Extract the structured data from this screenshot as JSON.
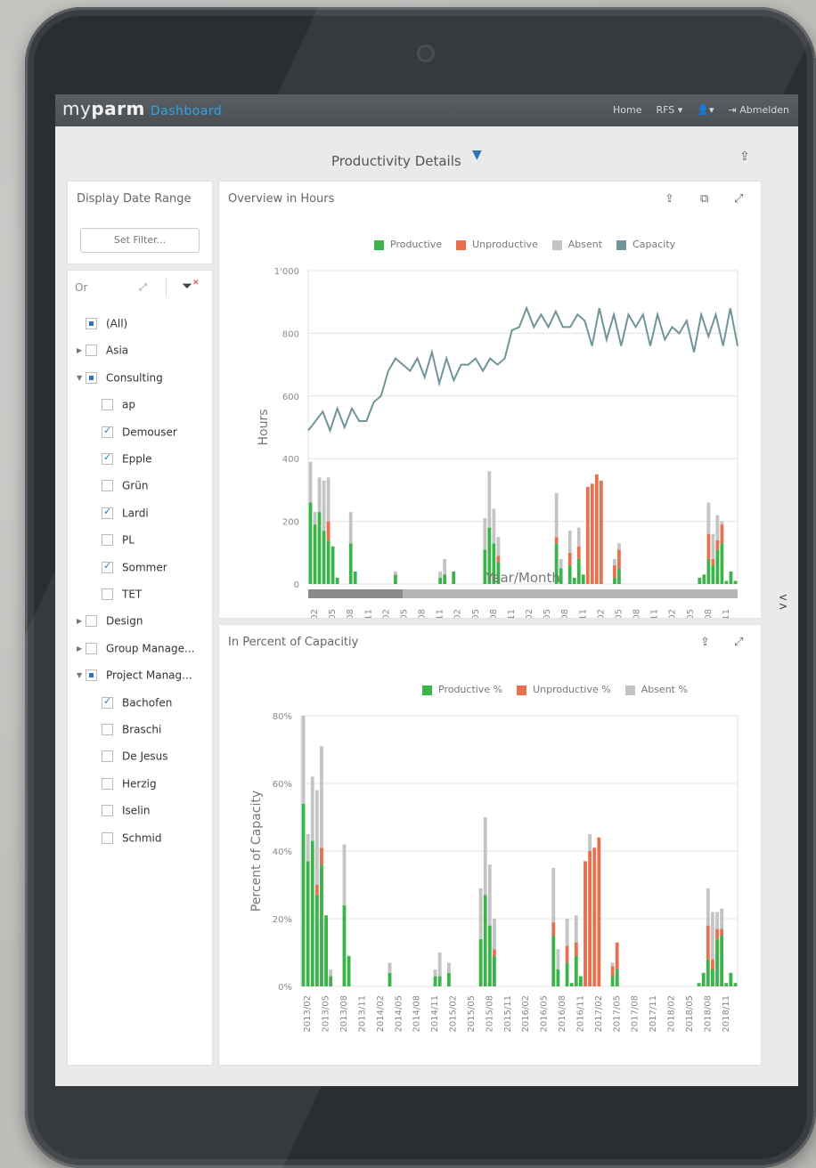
{
  "app": {
    "brand_prefix": "my",
    "brand_main": "parm",
    "brand_section": "Dashboard",
    "nav": {
      "home": "Home",
      "rfs": "RFS ▾",
      "user": "👤▾",
      "logout": "Abmelden"
    }
  },
  "page": {
    "title": "Productivity Details"
  },
  "date_panel": {
    "title": "Display Date Range",
    "button": "Set Filter..."
  },
  "tree": {
    "header": "Or",
    "items": [
      {
        "label": "(All)",
        "state": "partial",
        "arrow": "",
        "indent": 1
      },
      {
        "label": "Asia",
        "state": "none",
        "arrow": "▶",
        "indent": 0
      },
      {
        "label": "Consulting",
        "state": "partial",
        "arrow": "▼",
        "indent": 0
      },
      {
        "label": "ap",
        "state": "none",
        "arrow": "",
        "indent": 2
      },
      {
        "label": "Demouser",
        "state": "check",
        "arrow": "",
        "indent": 2
      },
      {
        "label": "Epple",
        "state": "check",
        "arrow": "",
        "indent": 2
      },
      {
        "label": "Grün",
        "state": "none",
        "arrow": "",
        "indent": 2
      },
      {
        "label": "Lardi",
        "state": "check",
        "arrow": "",
        "indent": 2
      },
      {
        "label": "PL",
        "state": "none",
        "arrow": "",
        "indent": 2
      },
      {
        "label": "Sommer",
        "state": "check",
        "arrow": "",
        "indent": 2
      },
      {
        "label": "TET",
        "state": "none",
        "arrow": "",
        "indent": 2
      },
      {
        "label": "Design",
        "state": "none",
        "arrow": "▶",
        "indent": 0
      },
      {
        "label": "Group Manage...",
        "state": "none",
        "arrow": "▶",
        "indent": 0
      },
      {
        "label": "Project Manag...",
        "state": "partial",
        "arrow": "▼",
        "indent": 0
      },
      {
        "label": "Bachofen",
        "state": "check",
        "arrow": "",
        "indent": 2
      },
      {
        "label": "Braschi",
        "state": "none",
        "arrow": "",
        "indent": 2
      },
      {
        "label": "De Jesus",
        "state": "none",
        "arrow": "",
        "indent": 2
      },
      {
        "label": "Herzig",
        "state": "none",
        "arrow": "",
        "indent": 2
      },
      {
        "label": "Iselin",
        "state": "none",
        "arrow": "",
        "indent": 2
      },
      {
        "label": "Schmid",
        "state": "none",
        "arrow": "",
        "indent": 2
      }
    ]
  },
  "colors": {
    "productive": "#3cb44b",
    "unproductive": "#e8704f",
    "absent": "#c4c4c4",
    "capacity": "#6f9599"
  },
  "chart_data": [
    {
      "type": "bar",
      "title": "Overview in Hours",
      "xlabel": "Year/Month",
      "ylabel": "Hours",
      "ylim": [
        0,
        1000
      ],
      "yticks": [
        "0",
        "200",
        "400",
        "600",
        "800",
        "1'000"
      ],
      "xticks": [
        "2013/02",
        "2013/05",
        "2013/08",
        "2013/11",
        "2014/02",
        "2014/05",
        "2014/08",
        "2014/11",
        "2015/02",
        "2015/05",
        "2015/08",
        "2015/11",
        "2016/02",
        "2016/05",
        "2016/08",
        "2016/11",
        "2017/02",
        "2017/05",
        "2017/08",
        "2017/11",
        "2018/02",
        "2018/05",
        "2018/08",
        "2018/11"
      ],
      "legend": [
        "Productive",
        "Unproductive",
        "Absent",
        "Capacity"
      ],
      "series": [
        {
          "name": "Productive",
          "values": [
            260,
            190,
            230,
            170,
            140,
            120,
            20,
            0,
            0,
            130,
            40,
            0,
            0,
            0,
            0,
            0,
            0,
            0,
            0,
            30,
            0,
            0,
            0,
            0,
            0,
            0,
            0,
            0,
            0,
            20,
            30,
            0,
            40,
            0,
            0,
            0,
            0,
            0,
            0,
            110,
            180,
            130,
            70,
            0,
            0,
            0,
            0,
            0,
            0,
            0,
            0,
            0,
            0,
            0,
            0,
            130,
            50,
            0,
            60,
            20,
            80,
            30,
            0,
            0,
            0,
            0,
            0,
            0,
            20,
            50,
            0,
            0,
            0,
            0,
            0,
            0,
            0,
            0,
            0,
            0,
            0,
            0,
            0,
            0,
            0,
            0,
            0,
            20,
            30,
            80,
            60,
            110,
            130,
            10,
            40,
            10
          ]
        },
        {
          "name": "Unproductive",
          "values": [
            0,
            0,
            0,
            0,
            60,
            0,
            0,
            0,
            0,
            0,
            0,
            0,
            0,
            0,
            0,
            0,
            0,
            0,
            0,
            0,
            0,
            0,
            0,
            0,
            0,
            0,
            0,
            0,
            0,
            0,
            0,
            0,
            0,
            0,
            0,
            0,
            0,
            0,
            0,
            0,
            0,
            0,
            20,
            0,
            0,
            0,
            0,
            0,
            0,
            0,
            0,
            0,
            0,
            0,
            0,
            20,
            0,
            0,
            40,
            0,
            40,
            0,
            310,
            320,
            350,
            330,
            0,
            0,
            40,
            60,
            0,
            0,
            0,
            0,
            0,
            0,
            0,
            0,
            0,
            0,
            0,
            0,
            0,
            0,
            0,
            0,
            0,
            0,
            0,
            80,
            20,
            30,
            60,
            0,
            0,
            0
          ]
        },
        {
          "name": "Absent",
          "values": [
            130,
            40,
            110,
            160,
            140,
            0,
            0,
            0,
            0,
            100,
            0,
            0,
            0,
            0,
            0,
            0,
            0,
            0,
            0,
            10,
            0,
            0,
            0,
            0,
            0,
            0,
            0,
            0,
            0,
            20,
            50,
            0,
            0,
            0,
            0,
            0,
            0,
            0,
            0,
            100,
            180,
            110,
            60,
            0,
            0,
            0,
            0,
            0,
            0,
            0,
            0,
            0,
            0,
            0,
            0,
            140,
            30,
            0,
            70,
            0,
            60,
            0,
            0,
            0,
            0,
            0,
            0,
            0,
            20,
            20,
            0,
            0,
            0,
            0,
            0,
            0,
            0,
            0,
            0,
            0,
            0,
            0,
            0,
            0,
            0,
            0,
            0,
            0,
            0,
            100,
            80,
            80,
            10,
            0,
            0,
            0
          ]
        },
        {
          "name": "Capacity",
          "values": [
            490,
            520,
            550,
            490,
            560,
            500,
            560,
            520,
            520,
            580,
            600,
            680,
            720,
            700,
            680,
            720,
            660,
            740,
            640,
            720,
            650,
            700,
            700,
            720,
            680,
            720,
            700,
            720,
            810,
            820,
            880,
            820,
            860,
            820,
            870,
            820,
            820,
            860,
            840,
            760,
            880,
            780,
            860,
            760,
            860,
            820,
            860,
            760,
            860,
            780,
            820,
            800,
            840,
            740,
            860,
            790,
            860,
            760,
            880,
            760
          ]
        }
      ]
    },
    {
      "type": "bar",
      "title": "In Percent of Capacitiy",
      "xlabel": "",
      "ylabel": "Percent of Capacity",
      "ylim": [
        0,
        80
      ],
      "yticks": [
        "0%",
        "20%",
        "40%",
        "60%",
        "80%"
      ],
      "xticks": [
        "2013/02",
        "2013/05",
        "2013/08",
        "2013/11",
        "2014/02",
        "2014/05",
        "2014/08",
        "2014/11",
        "2015/02",
        "2015/05",
        "2015/08",
        "2015/11",
        "2016/02",
        "2016/05",
        "2016/08",
        "2016/11",
        "2017/02",
        "2017/05",
        "2017/08",
        "2017/11",
        "2018/02",
        "2018/05",
        "2018/08",
        "2018/11"
      ],
      "legend": [
        "Productive %",
        "Unproductive %",
        "Absent %"
      ],
      "series": [
        {
          "name": "Productive %",
          "values": [
            54,
            37,
            43,
            27,
            36,
            21,
            3,
            0,
            0,
            24,
            9,
            0,
            0,
            0,
            0,
            0,
            0,
            0,
            0,
            4,
            0,
            0,
            0,
            0,
            0,
            0,
            0,
            0,
            0,
            3,
            3,
            0,
            4,
            0,
            0,
            0,
            0,
            0,
            0,
            14,
            27,
            18,
            9,
            0,
            0,
            0,
            0,
            0,
            0,
            0,
            0,
            0,
            0,
            0,
            0,
            15,
            5,
            0,
            7,
            1,
            9,
            3,
            0,
            0,
            0,
            0,
            0,
            0,
            3,
            5,
            0,
            0,
            0,
            0,
            0,
            0,
            0,
            0,
            0,
            0,
            0,
            0,
            0,
            0,
            0,
            0,
            0,
            1,
            4,
            8,
            5,
            14,
            15,
            1,
            4,
            1
          ]
        },
        {
          "name": "Unproductive %",
          "values": [
            0,
            0,
            0,
            3,
            5,
            0,
            0,
            0,
            0,
            0,
            0,
            0,
            0,
            0,
            0,
            0,
            0,
            0,
            0,
            0,
            0,
            0,
            0,
            0,
            0,
            0,
            0,
            0,
            0,
            0,
            0,
            0,
            0,
            0,
            0,
            0,
            0,
            0,
            0,
            0,
            0,
            0,
            2,
            0,
            0,
            0,
            0,
            0,
            0,
            0,
            0,
            0,
            0,
            0,
            0,
            4,
            0,
            0,
            5,
            0,
            4,
            0,
            37,
            40,
            41,
            44,
            0,
            0,
            3,
            8,
            0,
            0,
            0,
            0,
            0,
            0,
            0,
            0,
            0,
            0,
            0,
            0,
            0,
            0,
            0,
            0,
            0,
            0,
            0,
            10,
            3,
            3,
            2,
            0,
            0,
            0
          ]
        },
        {
          "name": "Absent %",
          "values": [
            26,
            8,
            19,
            28,
            30,
            0,
            2,
            0,
            0,
            18,
            0,
            0,
            0,
            0,
            0,
            0,
            0,
            0,
            0,
            3,
            0,
            0,
            0,
            0,
            0,
            0,
            0,
            0,
            0,
            2,
            7,
            0,
            3,
            0,
            0,
            0,
            0,
            0,
            0,
            15,
            23,
            18,
            9,
            0,
            0,
            0,
            0,
            0,
            0,
            0,
            0,
            0,
            0,
            0,
            0,
            16,
            6,
            0,
            8,
            0,
            8,
            0,
            0,
            5,
            0,
            0,
            0,
            0,
            1,
            0,
            0,
            0,
            0,
            0,
            0,
            0,
            0,
            0,
            0,
            0,
            0,
            0,
            0,
            0,
            0,
            0,
            0,
            0,
            0,
            11,
            14,
            5,
            6,
            0,
            0,
            0
          ]
        }
      ]
    }
  ]
}
